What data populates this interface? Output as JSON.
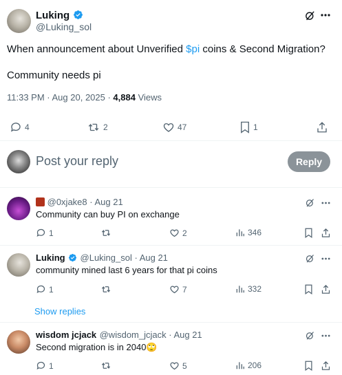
{
  "main_tweet": {
    "author_name": "Luking",
    "author_handle": "@Luking_sol",
    "text_prefix": "When announcement about Unverified ",
    "cashtag": "$pi",
    "text_suffix": " coins & Second Migration?",
    "text_line2": "Community needs pi",
    "timestamp": "11:33 PM · Aug 20, 2025 · ",
    "views_count": "4,884",
    "views_label": " Views",
    "replies": "4",
    "reposts": "2",
    "likes": "47",
    "bookmarks": "1"
  },
  "compose": {
    "placeholder": "Post your reply",
    "reply_label": "Reply"
  },
  "replies": [
    {
      "name": "",
      "handle": "@0xjake8",
      "date": " · Aug 21",
      "text": "Community can buy PI on exchange",
      "replies": "1",
      "reposts": "",
      "likes": "2",
      "views": "346"
    },
    {
      "name": "Luking",
      "handle": "@Luking_sol",
      "date": " · Aug 21",
      "text": "community mined last 6 years for that pi coins",
      "replies": "1",
      "reposts": "",
      "likes": "7",
      "views": "332"
    },
    {
      "name": "wisdom jcjack",
      "handle": "@wisdom_jcjack",
      "date": " · Aug 21",
      "text": "Second migration is in 2040🙄",
      "replies": "1",
      "reposts": "",
      "likes": "5",
      "views": "206"
    }
  ],
  "show_replies_label": "Show replies",
  "colors": {
    "accent": "#1d9bf0",
    "text": "#0f1419",
    "muted": "#536471",
    "reply_btn": "#8b9399"
  },
  "icons": [
    "grok-icon",
    "more-icon",
    "verified-icon",
    "reply-icon",
    "repost-icon",
    "like-icon",
    "bookmark-icon",
    "share-icon",
    "views-icon"
  ]
}
